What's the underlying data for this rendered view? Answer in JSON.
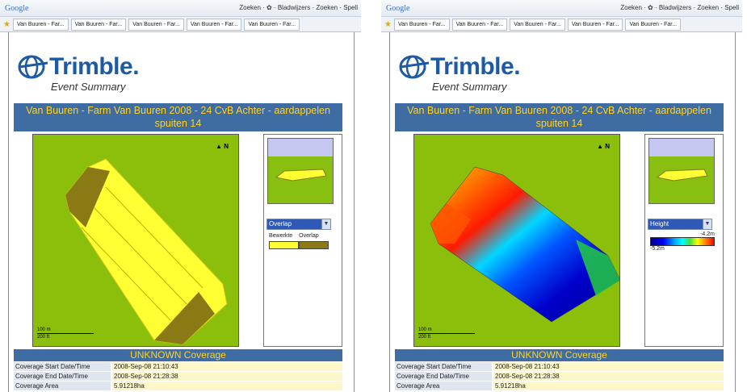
{
  "browser": {
    "google_label": "Google",
    "toolbar_menu": "Zoeken · ✿ · Bladwijzers · Zoeken · Spell",
    "tab_label": "Van Buuren - Far..."
  },
  "report": {
    "brand": "Trimble.",
    "subtitle": "Event Summary",
    "title": "Van Buuren - Farm Van Buuren 2008 - 24 CvB Achter - aardappelen spuiten 14",
    "north": "▲ N",
    "scale": [
      "100 m",
      "200 ft"
    ],
    "coverage_title": "UNKNOWN Coverage",
    "coverage_rows": [
      {
        "label": "Coverage Start Date/Time",
        "value": "2008-Sep-08 21:10:43"
      },
      {
        "label": "Coverage End Date/Time",
        "value": "2008-Sep-08 21:28:38"
      },
      {
        "label": "Coverage Area",
        "value": "5.91218ha"
      }
    ]
  },
  "left_panel": {
    "layer_select": "Overlap",
    "legend_labels": [
      "Bewerkte",
      "Overlap"
    ],
    "legend_colors": [
      "#ffff33",
      "#8a7a16"
    ]
  },
  "right_panel": {
    "layer_select": "Height",
    "legend_max": "-4.2m",
    "legend_min": "-5.2m"
  },
  "colors": {
    "title_bar": "#3e6ca3",
    "title_text": "#ffd320",
    "map_background": "#8bbf0c"
  }
}
